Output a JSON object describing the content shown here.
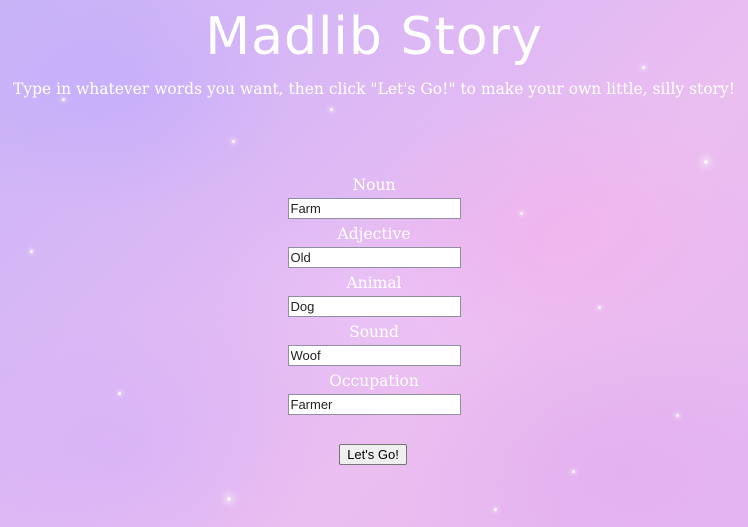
{
  "header": {
    "title": "Madlib Story",
    "subtitle": "Type in whatever words you want, then click \"Let's Go!\" to make your own little, silly story!"
  },
  "form": {
    "fields": [
      {
        "label": "Noun",
        "value": "Farm"
      },
      {
        "label": "Adjective",
        "value": "Old"
      },
      {
        "label": "Animal",
        "value": "Dog"
      },
      {
        "label": "Sound",
        "value": "Woof"
      },
      {
        "label": "Occupation",
        "value": "Farmer"
      }
    ],
    "submit_label": "Let's Go!"
  },
  "colors": {
    "text": "#ffffff",
    "background_start": "#c9b4f7",
    "background_end": "#ebbef0"
  }
}
